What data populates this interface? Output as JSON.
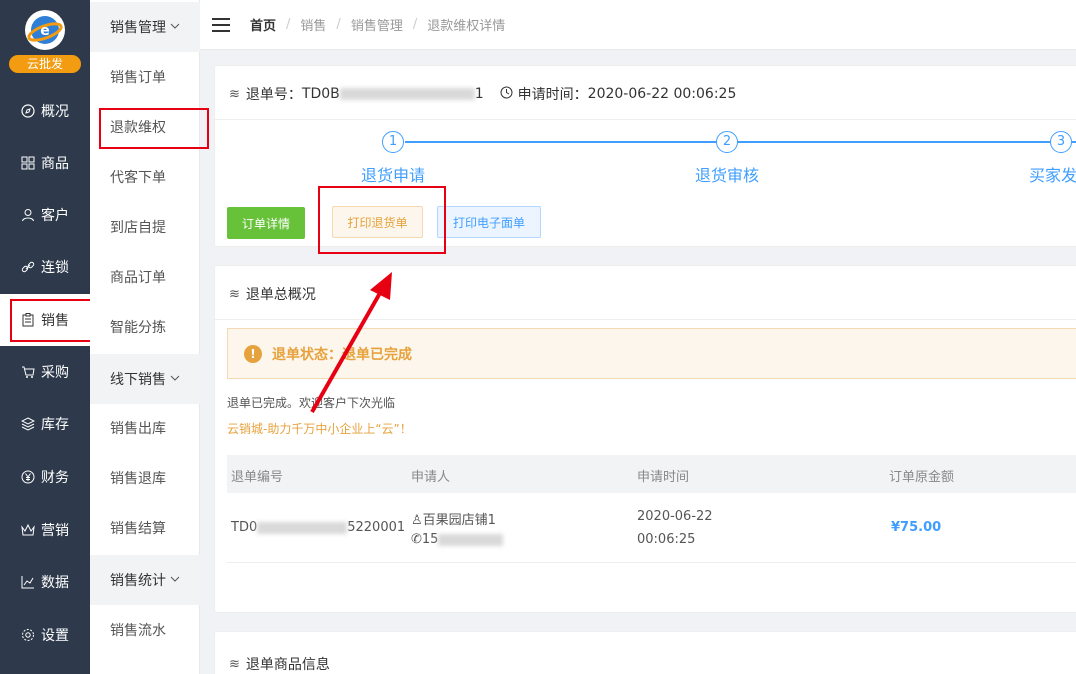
{
  "logo": {
    "badge": "云批发"
  },
  "nav": [
    {
      "label": "概况",
      "icon": "compass-icon"
    },
    {
      "label": "商品",
      "icon": "grid-icon"
    },
    {
      "label": "客户",
      "icon": "user-icon"
    },
    {
      "label": "连锁",
      "icon": "link-icon"
    },
    {
      "label": "销售",
      "icon": "clipboard-icon"
    },
    {
      "label": "采购",
      "icon": "cart-icon"
    },
    {
      "label": "库存",
      "icon": "layers-icon"
    },
    {
      "label": "财务",
      "icon": "yen-icon"
    },
    {
      "label": "营销",
      "icon": "crown-icon"
    },
    {
      "label": "数据",
      "icon": "chart-icon"
    },
    {
      "label": "设置",
      "icon": "gear-icon"
    }
  ],
  "subnav": {
    "group1": "销售管理",
    "items1": [
      "销售订单",
      "退款维权",
      "代客下单",
      "到店自提",
      "商品订单",
      "智能分拣"
    ],
    "group2": "线下销售",
    "items2": [
      "销售出库",
      "销售退库",
      "销售结算"
    ],
    "group3": "销售统计",
    "items3": [
      "销售流水"
    ]
  },
  "breadcrumb": [
    "首页",
    "销售",
    "销售管理",
    "退款维权详情"
  ],
  "refund": {
    "no_label": "退单号：",
    "no_start": "TD0B",
    "no_end": "1",
    "time_label": "申请时间：",
    "time": "2020-06-22 00:06:25"
  },
  "steps": [
    {
      "num": "1",
      "label": "退货申请"
    },
    {
      "num": "2",
      "label": "退货审核"
    },
    {
      "num": "3",
      "label": "买家发"
    }
  ],
  "buttons": {
    "order_detail": "订单详情",
    "print_return": "打印退货单",
    "print_waybill": "打印电子面单"
  },
  "overview": {
    "title": "退单总概况",
    "status": "退单状态：退单已完成",
    "note": "退单已完成。欢迎客户下次光临",
    "slogan": "云销城-助力千万中小企业上“云”！"
  },
  "table": {
    "headers": [
      "退单编号",
      "申请人",
      "申请时间",
      "订单原金额"
    ],
    "row": {
      "no_start": "TD0",
      "no_end": "5220001",
      "applicant": "百果园店铺1",
      "phone_start": "15",
      "date": "2020-06-22",
      "time": "00:06:25",
      "amount": "¥75.00"
    }
  },
  "goods": {
    "title": "退单商品信息"
  }
}
